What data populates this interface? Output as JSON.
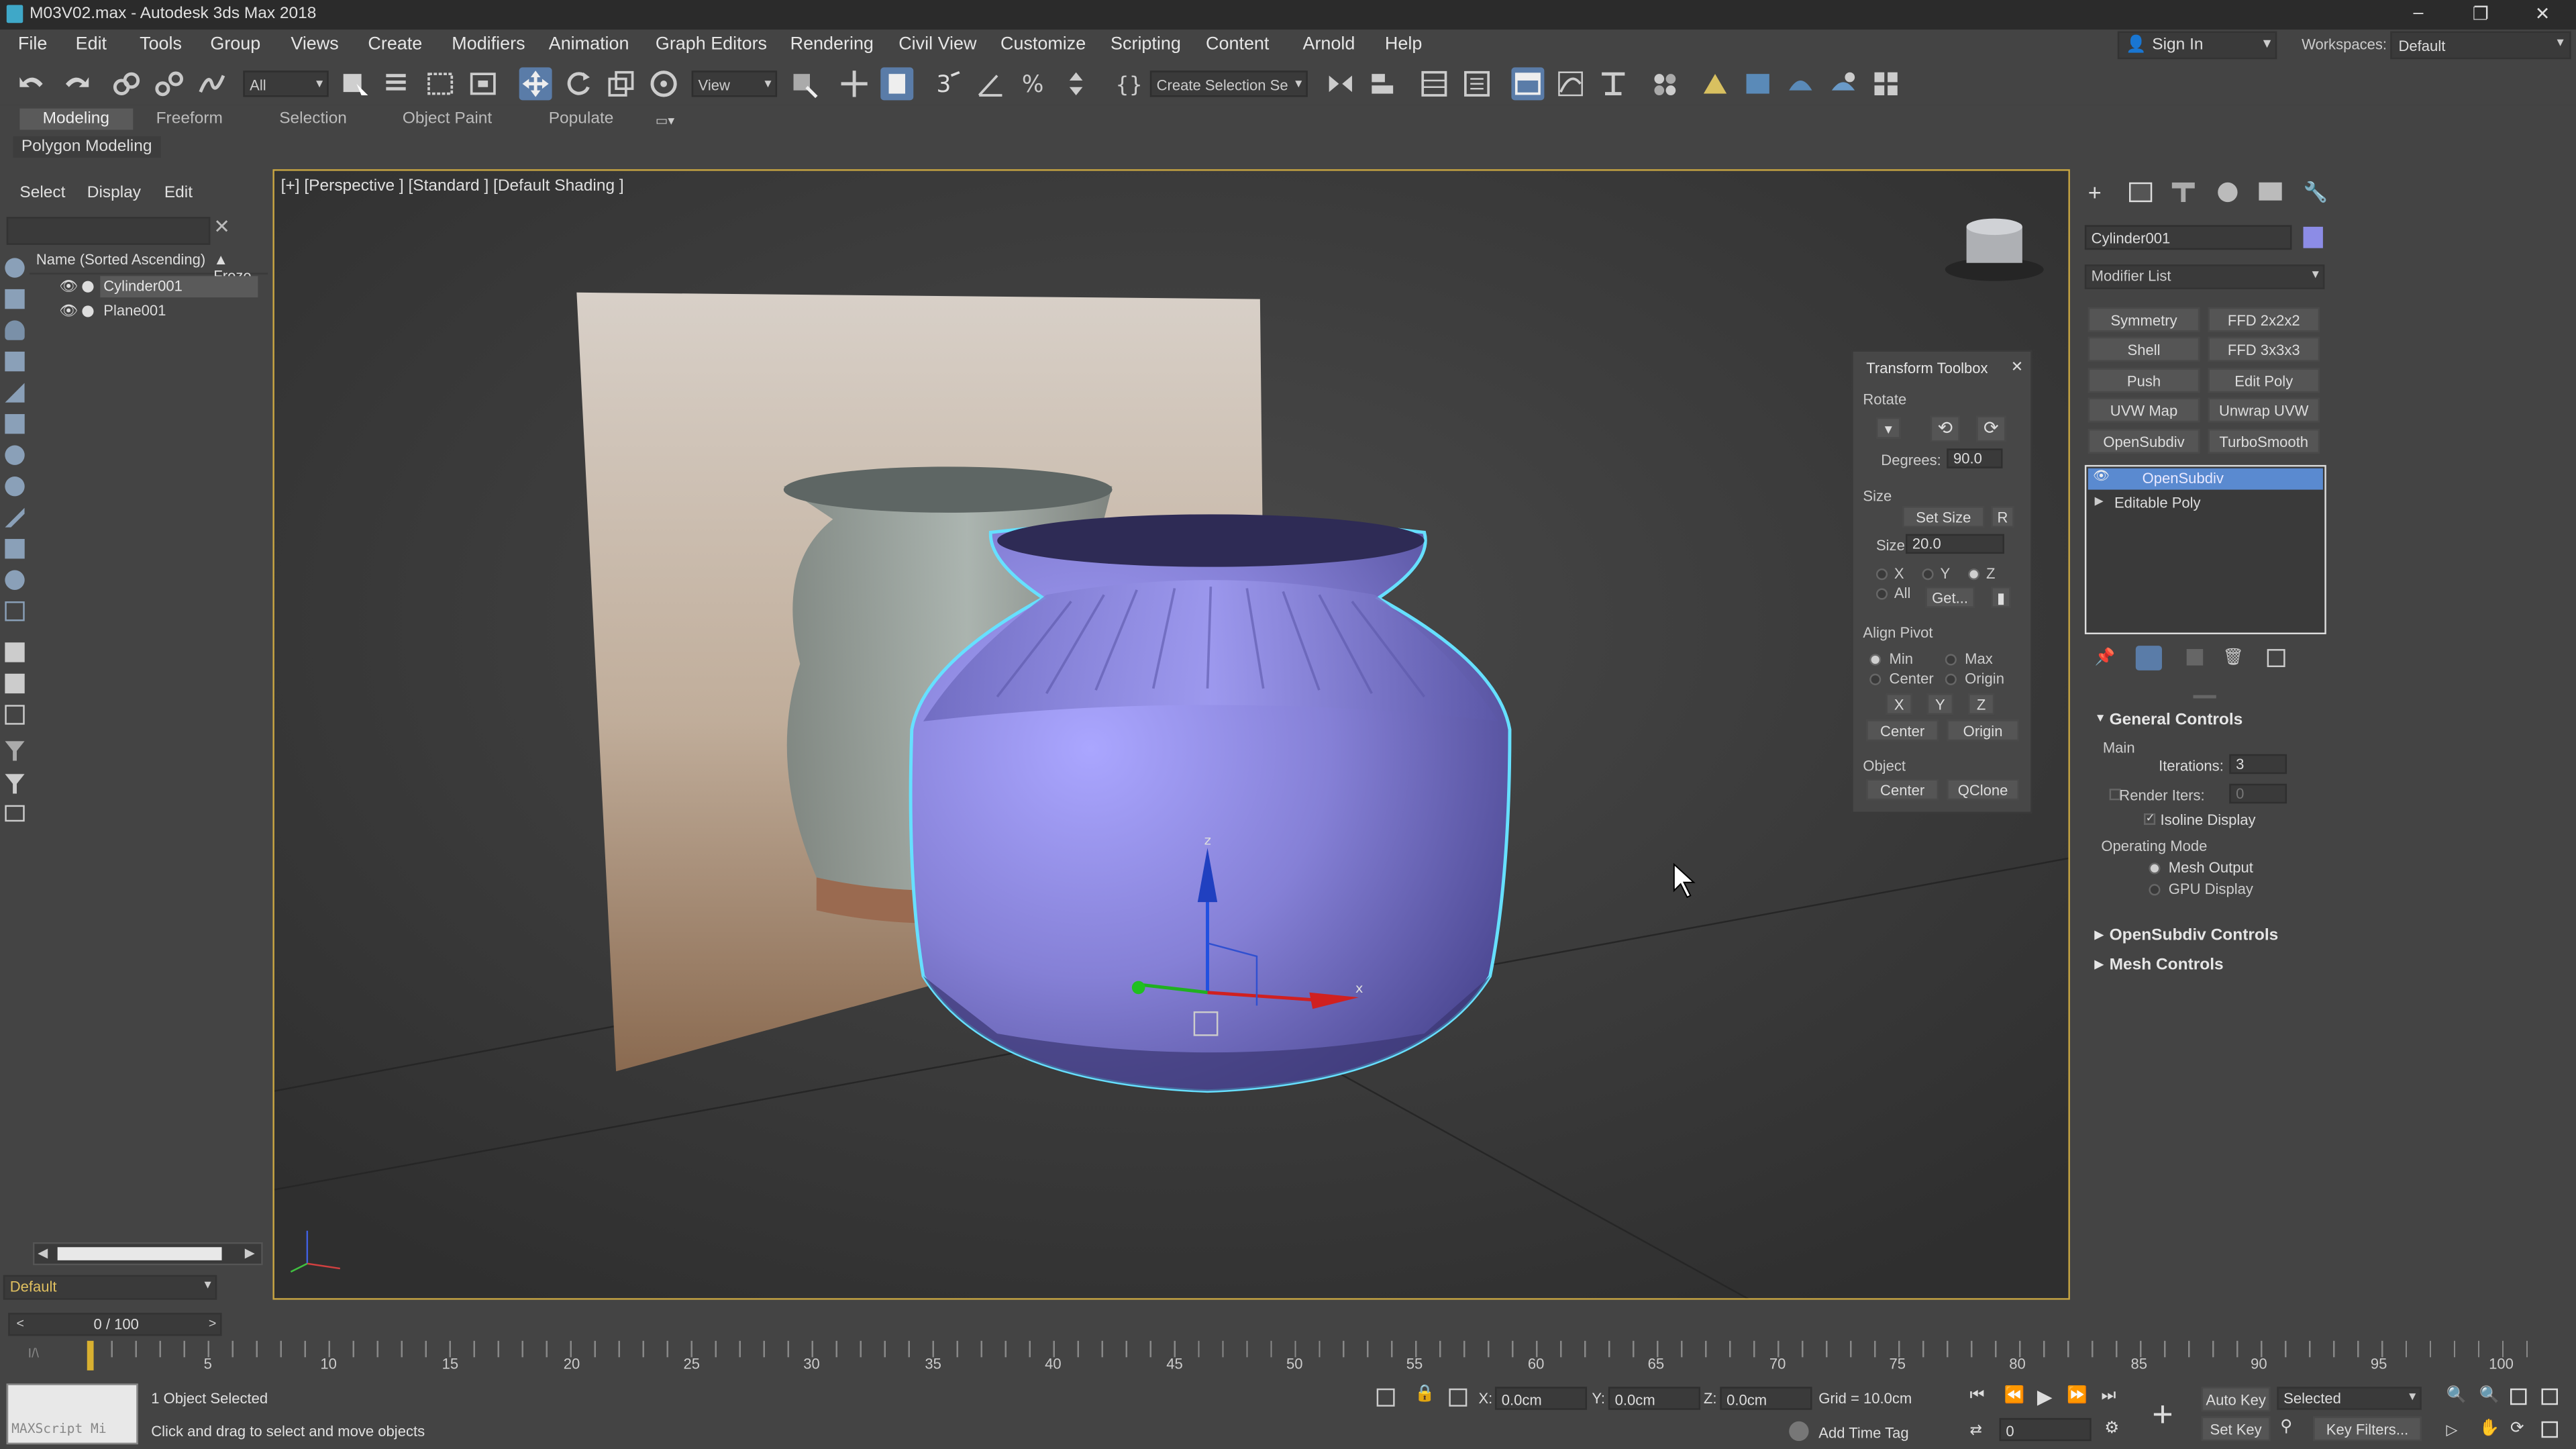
{
  "window": {
    "title": "M03V02.max - Autodesk 3ds Max 2018",
    "minimize": "–",
    "maximize": "❐",
    "close": "✕"
  },
  "menu": [
    "File",
    "Edit",
    "Tools",
    "Group",
    "Views",
    "Create",
    "Modifiers",
    "Animation",
    "Graph Editors",
    "Rendering",
    "Civil View",
    "Customize",
    "Scripting",
    "Content",
    "Arnold",
    "Help"
  ],
  "account": {
    "signin": "Sign In",
    "workspaces_label": "Workspaces:",
    "workspace": "Default"
  },
  "toolbar": {
    "filter_value": "All",
    "refcoord_value": "View",
    "selection_set": "Create Selection Se"
  },
  "ribbon": {
    "tabs": [
      "Modeling",
      "Freeform",
      "Selection",
      "Object Paint",
      "Populate"
    ],
    "active_tab": "Modeling",
    "sub_label": "Polygon Modeling"
  },
  "explorer": {
    "menu": [
      "Select",
      "Display",
      "Edit"
    ],
    "column_name": "Name (Sorted Ascending)",
    "column_frozen": "▲ Froze",
    "objects": [
      {
        "name": "Cylinder001",
        "selected": true
      },
      {
        "name": "Plane001",
        "selected": false
      }
    ],
    "layer": "Default",
    "scroll_left": "◀",
    "scroll_right": "▶"
  },
  "viewport": {
    "label": "[+] [Perspective ] [Standard ] [Default Shading ]",
    "object_color": "#8c87d9",
    "highlight_color": "#66e0ff",
    "gizmo_z": "z",
    "gizmo_x": "x"
  },
  "toolbox": {
    "title": "Transform Toolbox",
    "close": "✕",
    "rotate_label": "Rotate",
    "degrees_label": "Degrees:",
    "degrees_value": "90.0",
    "size_label": "Size",
    "set_size": "Set Size",
    "r_btn": "R",
    "size_field_label": "Size",
    "size_value": "20.0",
    "axes": [
      "X",
      "Y",
      "Z"
    ],
    "all_label": "All",
    "get_btn": "Get...",
    "align_pivot_label": "Align Pivot",
    "pivot_opts": [
      "Min",
      "Max",
      "Center",
      "Origin"
    ],
    "xyz_btns": [
      "X",
      "Y",
      "Z"
    ],
    "center_btn": "Center",
    "origin_btn": "Origin",
    "object_label": "Object",
    "obj_center_btn": "Center",
    "qclone_btn": "QClone"
  },
  "cmdpanel": {
    "object_name": "Cylinder001",
    "object_color": "#8c8ce6",
    "modifier_list": "Modifier List",
    "buttons": [
      "Symmetry",
      "FFD 2x2x2",
      "Shell",
      "FFD 3x3x3",
      "Push",
      "Edit Poly",
      "UVW Map",
      "Unwrap UVW",
      "OpenSubdiv",
      "TurboSmooth"
    ],
    "stack": [
      "OpenSubdiv",
      "Editable Poly"
    ],
    "general_controls": "General Controls",
    "main_label": "Main",
    "iterations_label": "Iterations:",
    "iterations_value": "3",
    "render_iters_label": "Render Iters:",
    "render_iters_value": "0",
    "isoline_label": "Isoline Display",
    "operating_mode_label": "Operating Mode",
    "mesh_output_label": "Mesh Output",
    "gpu_display_label": "GPU Display",
    "opensubdiv_controls": "OpenSubdiv Controls",
    "mesh_controls": "Mesh Controls"
  },
  "timeline": {
    "frame_display": "0 / 100",
    "ticks": [
      "5",
      "10",
      "15",
      "20",
      "25",
      "30",
      "35",
      "40",
      "45",
      "50",
      "55",
      "60",
      "65",
      "70",
      "75",
      "80",
      "85",
      "90",
      "95",
      "100"
    ]
  },
  "status": {
    "maxscript": "MAXScript Mi",
    "selected_msg": "1 Object Selected",
    "prompt": "Click and drag to select and move objects",
    "x_label": "X:",
    "x_value": "0.0cm",
    "y_label": "Y:",
    "y_value": "0.0cm",
    "z_label": "Z:",
    "z_value": "0.0cm",
    "grid": "Grid = 10.0cm",
    "add_time_tag": "Add Time Tag",
    "auto_key": "Auto Key",
    "set_key": "Set Key",
    "selected_dd": "Selected",
    "key_filters": "Key Filters...",
    "frame_value": "0"
  }
}
